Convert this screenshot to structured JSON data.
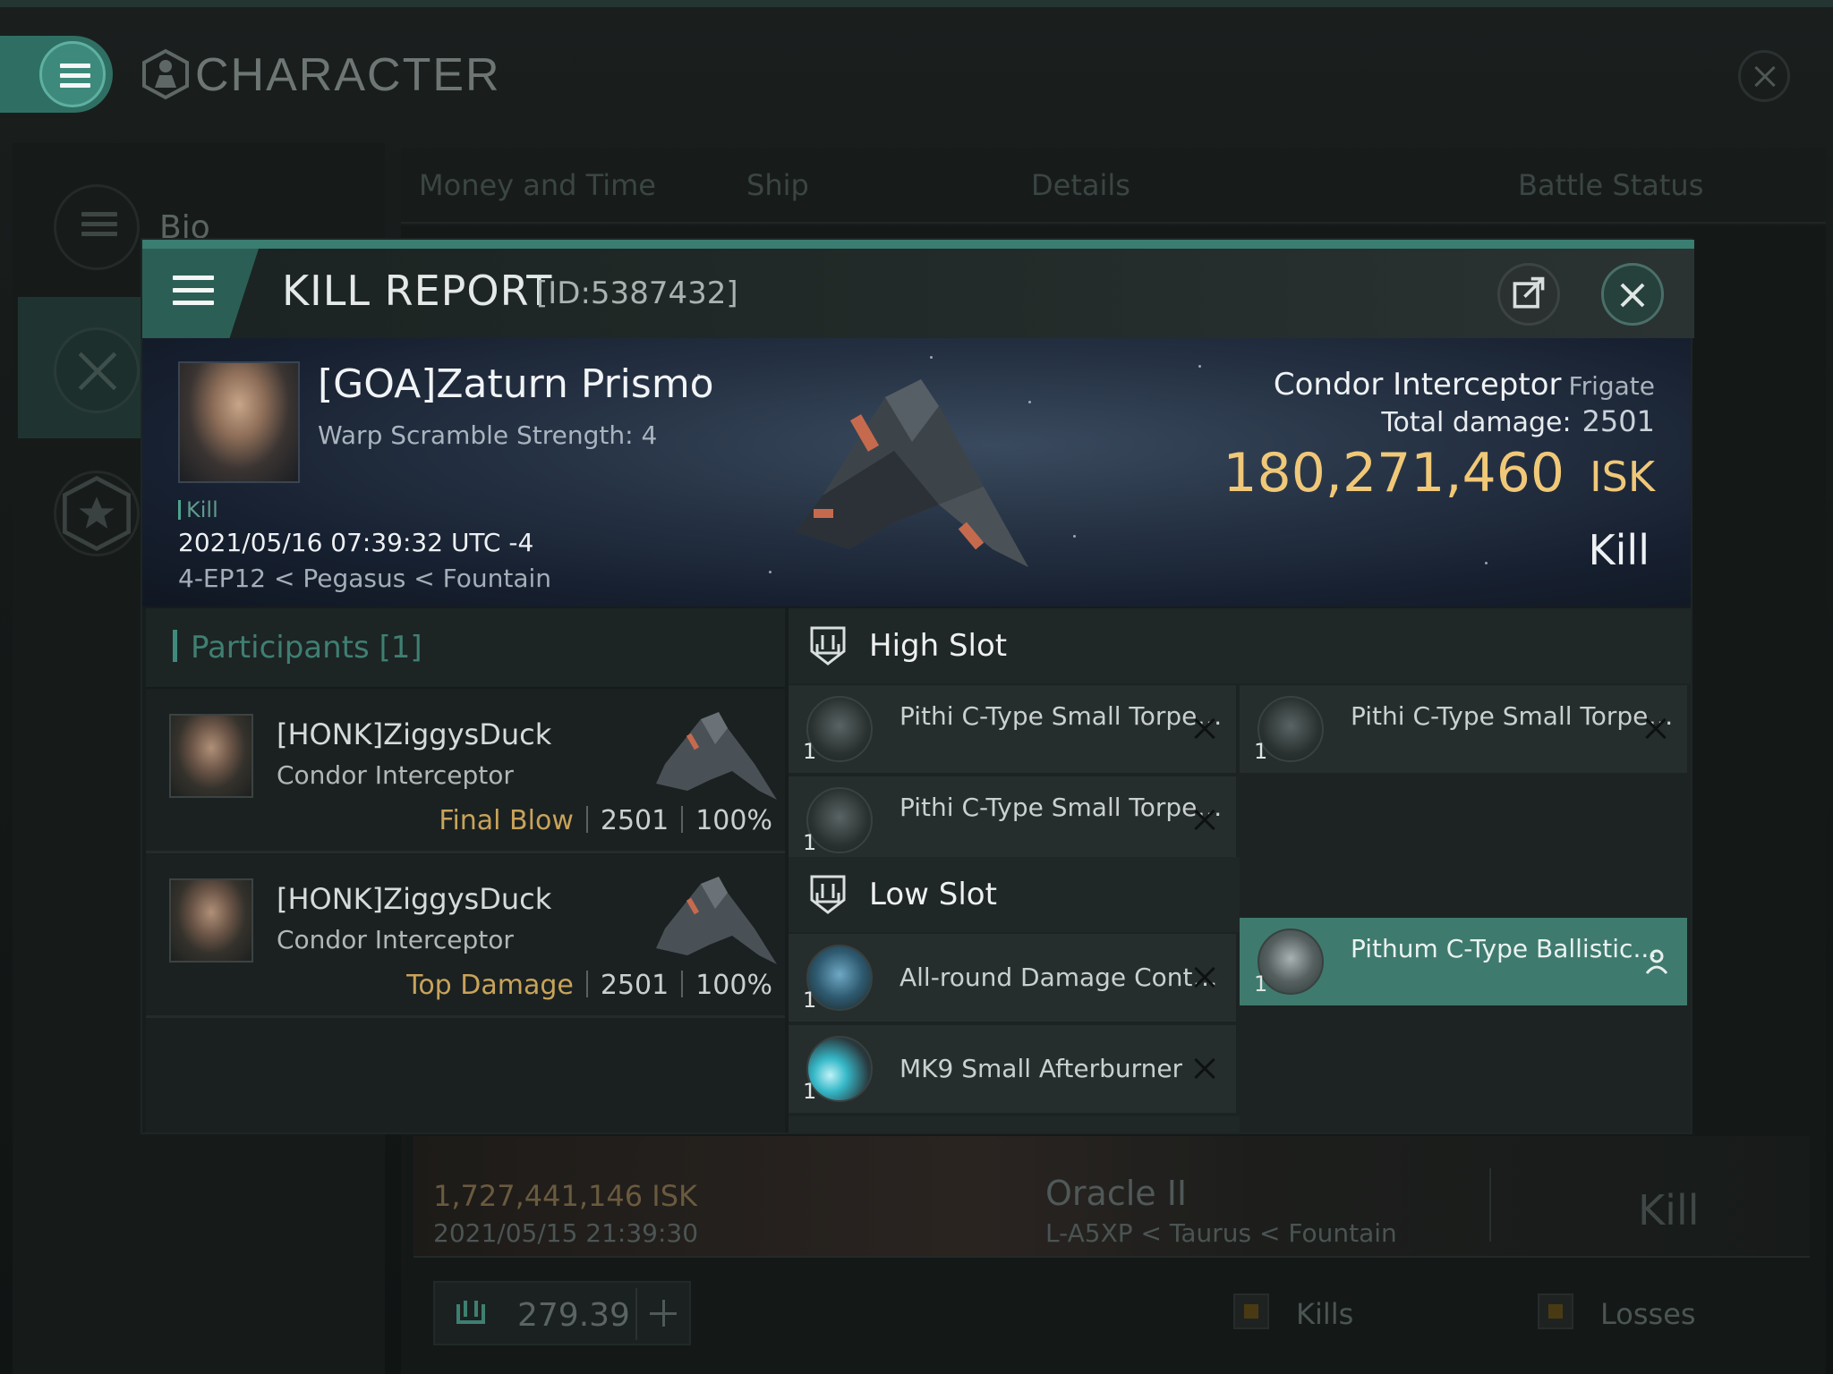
{
  "window": {
    "title": "CHARACTER"
  },
  "left_nav": {
    "bio_label": "Bio"
  },
  "tabs": [
    "Money and Time",
    "Ship",
    "Details",
    "Battle Status"
  ],
  "background_row": {
    "isk": "1,727,441,146  ISK",
    "date": "2021/05/15  21:39:30",
    "ship": "Oracle II",
    "location": "L-A5XP < Taurus < Fountain",
    "result": "Kill"
  },
  "bottom_bar": {
    "amount": "279.39",
    "kills_label": "Kills",
    "losses_label": "Losses"
  },
  "kill_report": {
    "title": "KILL REPORT",
    "id": "[ID:5387432]",
    "victim": {
      "name": "[GOA]Zaturn Prismo",
      "warp_scramble": "Warp Scramble Strength: 4",
      "tag": "Kill",
      "datetime": "2021/05/16 07:39:32 UTC -4",
      "location": "4-EP12 < Pegasus < Fountain"
    },
    "ship": {
      "name": "Condor Interceptor",
      "class": "Frigate",
      "total_damage_label": "Total damage:",
      "total_damage": "2501",
      "isk_value": "180,271,460",
      "isk_unit": "ISK",
      "result": "Kill"
    },
    "participants": {
      "title": "Participants [1]",
      "items": [
        {
          "name": "[HONK]ZiggysDuck",
          "ship": "Condor Interceptor",
          "tag": "Final Blow",
          "damage": "2501",
          "percent": "100%"
        },
        {
          "name": "[HONK]ZiggysDuck",
          "ship": "Condor Interceptor",
          "tag": "Top Damage",
          "damage": "2501",
          "percent": "100%"
        }
      ]
    },
    "fitting": {
      "high_slot_title": "High Slot",
      "high_slot": [
        {
          "name": "Pithi C-Type Small Torpedo ...",
          "qty": "1"
        },
        {
          "name": "Pithi C-Type Small Torpedo ...",
          "qty": "1"
        },
        {
          "name": "Pithi C-Type Small Torpedo ...",
          "qty": "1"
        }
      ],
      "low_slot_title": "Low Slot",
      "low_slot": [
        {
          "name": "All-round Damage Control",
          "qty": "1"
        },
        {
          "name": "Pithum C-Type Ballistic...",
          "qty": "1"
        },
        {
          "name": "MK9 Small Afterburner",
          "qty": "1"
        }
      ]
    }
  },
  "colors": {
    "accent": "#3a7d71",
    "isk": "#f0c878",
    "tag_gold": "#c9a35a",
    "highlight": "#3f7a6e"
  },
  "icons": [
    "menu-icon",
    "character-icon",
    "close-icon",
    "crossed-swords-icon",
    "star-icon",
    "external-link-icon",
    "high-slot-icon",
    "low-slot-icon",
    "person-icon",
    "plus-icon"
  ]
}
